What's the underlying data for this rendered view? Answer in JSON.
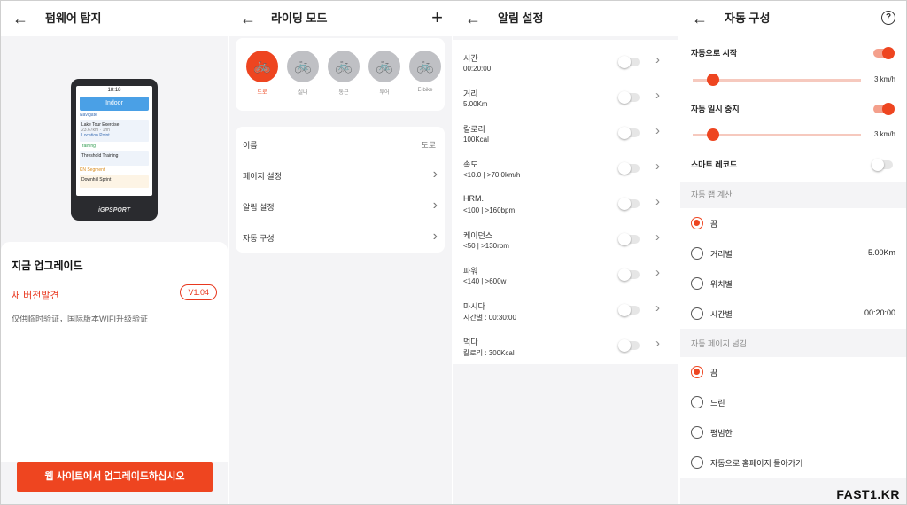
{
  "firmware": {
    "title": "펌웨어 탐지",
    "device": {
      "status_time": "18:18",
      "indoor_label": "Indoor",
      "navigate_label": "Navigate",
      "route_name": "Lake Tour Exercise",
      "route_detail": "23.67km · 1hh",
      "location_label": "Location Point",
      "training_label": "Training",
      "training_name": "Threshold Training",
      "segment_label": "KN Segment",
      "segment_name": "Downhill Sprint",
      "brand": "iGPSPORT"
    },
    "upgrade_title": "지금 업그레이드",
    "new_version_label": "새 버전발견",
    "version_badge": "V1.04",
    "note": "仅供临时验证，国际版本WIFI升级验证",
    "upgrade_button": "웹 사이트에서 업그레이드하십시오"
  },
  "riding_mode": {
    "title": "라이딩 모드",
    "add_icon": "+",
    "modes": [
      {
        "label": "도로",
        "active": true
      },
      {
        "label": "실내",
        "active": false
      },
      {
        "label": "통근",
        "active": false
      },
      {
        "label": "투어",
        "active": false
      },
      {
        "label": "E-bike",
        "active": false
      }
    ],
    "rows": [
      {
        "label": "이름",
        "value": "도로"
      },
      {
        "label": "페이지 설정",
        "value": ""
      },
      {
        "label": "알림 설정",
        "value": ""
      },
      {
        "label": "자동 구성",
        "value": ""
      }
    ]
  },
  "alarm": {
    "title": "알림 설정",
    "items": [
      {
        "name": "시간",
        "sub": "00:20:00",
        "on": false
      },
      {
        "name": "거리",
        "sub": "5.00Km",
        "on": false
      },
      {
        "name": "칼로리",
        "sub": "100Kcal",
        "on": false
      },
      {
        "name": "속도",
        "sub": "<10.0 | >70.0km/h",
        "on": false
      },
      {
        "name": "HRM.",
        "sub": "<100 | >160bpm",
        "on": false
      },
      {
        "name": "케이던스",
        "sub": "<50 | >130rpm",
        "on": false
      },
      {
        "name": "파워",
        "sub": "<140 | >600w",
        "on": false
      },
      {
        "name": "마시다",
        "sub": "시간별 : 00:30:00",
        "on": false
      },
      {
        "name": "먹다",
        "sub": "칼로리 : 300Kcal",
        "on": false
      }
    ]
  },
  "auto_config": {
    "title": "자동 구성",
    "help_icon": "?",
    "auto_start_label": "자동으로 시작",
    "auto_start_on": true,
    "auto_start_value": "3 km/h",
    "auto_start_level": 0.12,
    "auto_pause_label": "자동 일시 중지",
    "auto_pause_on": true,
    "auto_pause_value": "3 km/h",
    "auto_pause_level": 0.12,
    "smart_record_label": "스마트 레코드",
    "smart_record_on": false,
    "lap_section": "자동 랩 계산",
    "lap_options": [
      {
        "label": "끔",
        "value": "",
        "selected": true
      },
      {
        "label": "거리별",
        "value": "5.00Km",
        "selected": false
      },
      {
        "label": "위치별",
        "value": "",
        "selected": false
      },
      {
        "label": "시간별",
        "value": "00:20:00",
        "selected": false
      }
    ],
    "page_section": "자동 페이지 넘김",
    "page_options": [
      {
        "label": "끔",
        "selected": true
      },
      {
        "label": "느린",
        "selected": false
      },
      {
        "label": "평범한",
        "selected": false
      },
      {
        "label": "자동으로 홈페이지 돌아가기",
        "selected": false
      }
    ]
  },
  "watermark": "FAST1.KR",
  "colors": {
    "accent": "#ee4520",
    "background": "#f4f4f6"
  }
}
